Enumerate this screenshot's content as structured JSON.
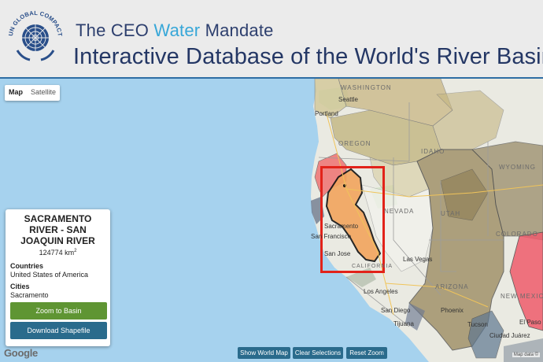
{
  "header": {
    "logo_text": "UN GLOBAL COMPACT",
    "title_prefix": "The CEO ",
    "title_highlight": "Water",
    "title_suffix": " Mandate",
    "subtitle": "Interactive Database of the World's River Basins"
  },
  "map_type": {
    "map_label": "Map",
    "satellite_label": "Satellite"
  },
  "map_labels": {
    "states": [
      "WASHINGTON",
      "OREGON",
      "IDAHO",
      "NEVADA",
      "UTAH",
      "ARIZONA",
      "WYOMING",
      "COLORADO",
      "NEW MEXICO",
      "CALIFORNIA"
    ],
    "cities": [
      "Seattle",
      "Portland",
      "San Francisco",
      "Sacramento",
      "San Jose",
      "Las Vegas",
      "Los Angeles",
      "San Diego",
      "Phoenix",
      "Tucson",
      "El Paso",
      "Tijuana",
      "Ciudad Juárez"
    ]
  },
  "info_panel": {
    "basin_name": "SACRAMENTO RIVER - SAN JOAQUIN RIVER",
    "area_value": "124774 km",
    "area_unit_sup": "2",
    "countries_label": "Countries",
    "countries_value": "United States of America",
    "cities_label": "Cities",
    "cities_value": "Sacramento",
    "zoom_button": "Zoom to Basin",
    "download_button": "Download Shapefile"
  },
  "controls": {
    "show_world_map": "Show World Map",
    "clear_selections": "Clear Selections",
    "reset_zoom": "Reset Zoom"
  },
  "attribution": {
    "google": "Google",
    "map_data": "Map data ©"
  },
  "colors": {
    "header_title": "#2d3f6e",
    "water_accent": "#37a7d8",
    "selected_basin_fill": "#f2a55e",
    "selection_box": "#e2231a",
    "zoom_button_bg": "#5f9533",
    "action_button_bg": "#2a6b8c"
  }
}
